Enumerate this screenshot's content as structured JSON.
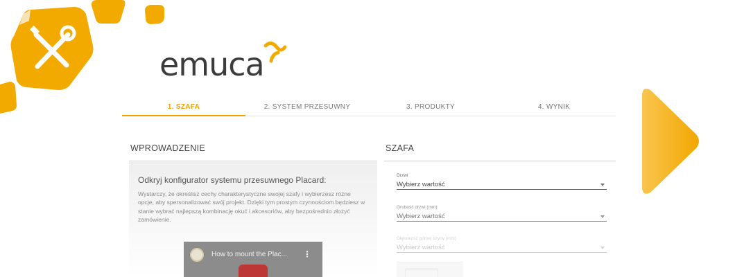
{
  "brand": {
    "logo_text": "emuca",
    "accent_color": "#f0a000"
  },
  "icons": {
    "tools": "wrench-screwdriver-icon",
    "next": "arrow-right-icon"
  },
  "tabs": [
    {
      "label": "1. SZAFA",
      "active": true
    },
    {
      "label": "2. SYSTEM PRZESUWNY",
      "active": false
    },
    {
      "label": "3. PRODUKTY",
      "active": false
    },
    {
      "label": "4. WYNIK",
      "active": false
    }
  ],
  "intro": {
    "section_title": "WPROWADZENIE",
    "heading": "Odkryj konfigurator systemu przesuwnego Placard:",
    "text": "Wystarczy, że określisz cechy charakterystyczne swojej szafy i wybierzesz różne opcje, aby spersonalizować swój projekt. Dzięki tym prostym czynnościom będziesz w stanie wybrać najlepszą kombinację okuć i akcesoriów, aby bezpośrednio złożyć zamówienie.",
    "video_title": "How to mount the Plac...",
    "video_more": "⋮"
  },
  "wardrobe": {
    "section_title": "SZAFA",
    "fields": [
      {
        "label": "Drzwi",
        "value": "Wybierz wartość"
      },
      {
        "label": "Grubość drzwi (mm)",
        "value": "Wybierz wartość"
      },
      {
        "label": "Głębokość górnej szyny (mm)",
        "value": "Wybierz wartość"
      }
    ]
  }
}
